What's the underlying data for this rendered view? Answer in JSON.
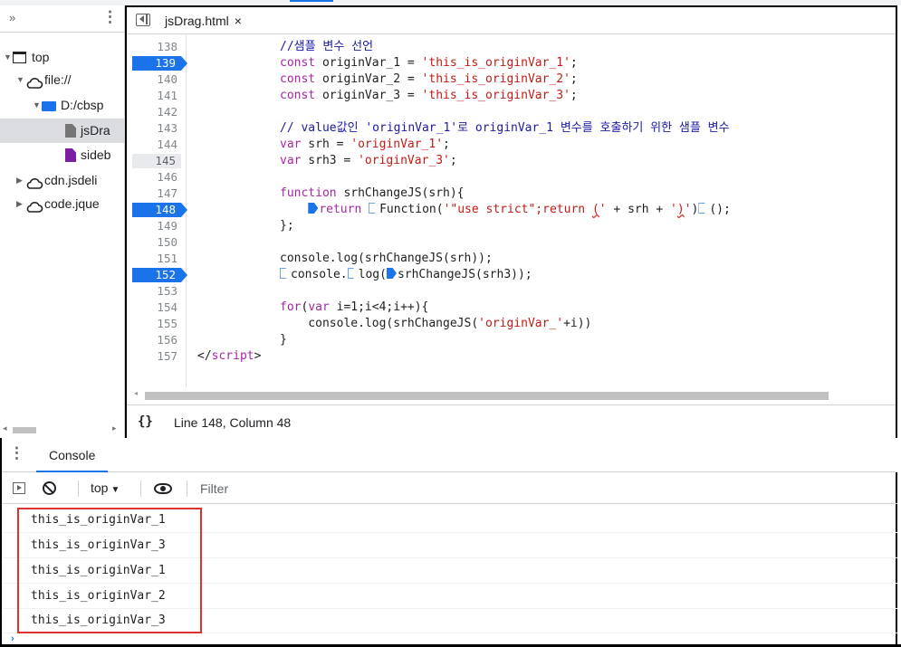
{
  "navigator": {
    "chevron": "»",
    "kebab": "⋮",
    "tree": [
      {
        "label": "top",
        "level": 0,
        "icon": "frame-icon",
        "expanded": true
      },
      {
        "label": "file://",
        "level": 1,
        "icon": "cloud-icon",
        "expanded": true
      },
      {
        "label": "D:/cbsp",
        "level": 2,
        "icon": "folder-icon",
        "expanded": true
      },
      {
        "label": "jsDra",
        "level": 3,
        "icon": "file-icon",
        "selected": true
      },
      {
        "label": "sideb",
        "level": 3,
        "icon": "file-purple-icon"
      },
      {
        "label": "cdn.jsdeli",
        "level": 1,
        "icon": "cloud-icon",
        "expanded": false
      },
      {
        "label": "code.jque",
        "level": 1,
        "icon": "cloud-icon",
        "expanded": false
      }
    ]
  },
  "editor": {
    "tab_label": "jsDrag.html",
    "tab_close": "×",
    "status_braces": "{}",
    "status_position": "Line 148, Column 48",
    "lines": [
      {
        "n": "138",
        "bp": false,
        "html": "<span class=\"cmt\">//샘플 변수 선언</span>"
      },
      {
        "n": "139",
        "bp": true,
        "html": "<span class=\"kw\">const</span> originVar_1 = <span class=\"str\">'this_is_originVar_1'</span>;"
      },
      {
        "n": "140",
        "bp": false,
        "html": "<span class=\"kw\">const</span> originVar_2 = <span class=\"str\">'this_is_originVar_2'</span>;"
      },
      {
        "n": "141",
        "bp": false,
        "html": "<span class=\"kw\">const</span> originVar_3 = <span class=\"str\">'this_is_originVar_3'</span>;"
      },
      {
        "n": "142",
        "bp": false,
        "html": ""
      },
      {
        "n": "143",
        "bp": false,
        "html": "<span class=\"cmt\">// value값인 'originVar_1'로 originVar_1 변수를 호출하기 위한 샘플 변수</span>"
      },
      {
        "n": "144",
        "bp": false,
        "html": "<span class=\"kw\">var</span> srh = <span class=\"str\">'originVar_1'</span>;"
      },
      {
        "n": "145",
        "bp": false,
        "cursor": true,
        "html": "<span class=\"kw\">var</span> srh3 = <span class=\"str\">'originVar_3'</span>;"
      },
      {
        "n": "146",
        "bp": false,
        "html": ""
      },
      {
        "n": "147",
        "bp": false,
        "html": "<span class=\"kw\">function</span> srhChangeJS(srh){"
      },
      {
        "n": "148",
        "bp": true,
        "html": "    <span class=\"mk on\"></span><span class=\"kw\">return</span> <span class=\"mk off\"></span>Function(<span class=\"str\">'\"use strict\";return <span class=\"squig\">(</span>'</span> + srh + <span class=\"str\">'<span class=\"squig\">)</span>'</span>)<span class=\"mk off\"></span>();"
      },
      {
        "n": "149",
        "bp": false,
        "html": "};"
      },
      {
        "n": "150",
        "bp": false,
        "html": ""
      },
      {
        "n": "151",
        "bp": false,
        "html": "console.log(srhChangeJS(srh));"
      },
      {
        "n": "152",
        "bp": true,
        "html": "<span class=\"mk off\"></span>console.<span class=\"mk off\"></span>log(<span class=\"mk on\"></span>srhChangeJS(srh3));"
      },
      {
        "n": "153",
        "bp": false,
        "html": ""
      },
      {
        "n": "154",
        "bp": false,
        "html": "<span class=\"kw\">for</span>(<span class=\"kw\">var</span> i=1;i&lt;4;i++){"
      },
      {
        "n": "155",
        "bp": false,
        "html": "    console.log(srhChangeJS(<span class=\"str\">'originVar_'</span>+i))"
      },
      {
        "n": "156",
        "bp": false,
        "html": "}"
      },
      {
        "n": "157",
        "bp": false,
        "outdent": true,
        "html": "&lt;/<span class=\"kw\">script</span>&gt;"
      }
    ]
  },
  "console": {
    "kebab": "⋮",
    "tab_label": "Console",
    "context": "top",
    "context_caret": "▼",
    "filter_placeholder": "Filter",
    "messages": [
      "this_is_originVar_1",
      "this_is_originVar_3",
      "this_is_originVar_1",
      "this_is_originVar_2",
      "this_is_originVar_3"
    ],
    "prompt": "›"
  },
  "colors": {
    "accent": "#1a73e8",
    "highlight_box": "#e03131",
    "string": "#c41a16",
    "keyword": "#a626a4",
    "comment": "#1a1aa6"
  }
}
